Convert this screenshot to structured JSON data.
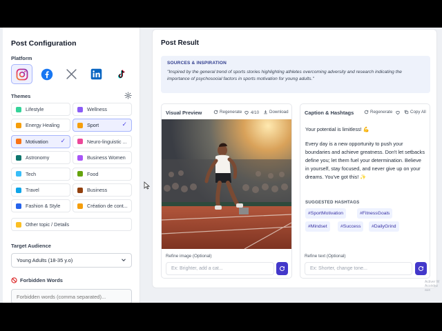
{
  "left_panel": {
    "title": "Post Configuration",
    "platform_label": "Platform",
    "platforms": [
      {
        "name": "Instagram",
        "icon": "instagram-icon",
        "selected": true,
        "color": "#e1306c"
      },
      {
        "name": "Facebook",
        "icon": "facebook-icon",
        "selected": false,
        "color": "#1877f2"
      },
      {
        "name": "X",
        "icon": "x-icon",
        "selected": false,
        "color": "#111111"
      },
      {
        "name": "LinkedIn",
        "icon": "linkedin-icon",
        "selected": false,
        "color": "#0a66c2"
      },
      {
        "name": "TikTok",
        "icon": "tiktok-icon",
        "selected": false,
        "color": "#111111"
      }
    ],
    "themes_label": "Themes",
    "themes": [
      {
        "label": "Lifestyle",
        "icon_color": "#34d399",
        "selected": false
      },
      {
        "label": "Wellness",
        "icon_color": "#8b5cf6",
        "selected": false
      },
      {
        "label": "Energy Healing",
        "icon_color": "#f59e0b",
        "selected": false
      },
      {
        "label": "Sport",
        "icon_color": "#f59e0b",
        "selected": true
      },
      {
        "label": "Motivation",
        "icon_color": "#f97316",
        "selected": true
      },
      {
        "label": "Neuro-linguistic ...",
        "icon_color": "#ec4899",
        "selected": false
      },
      {
        "label": "Astronomy",
        "icon_color": "#0f766e",
        "selected": false
      },
      {
        "label": "Business Women",
        "icon_color": "#a855f7",
        "selected": false
      },
      {
        "label": "Tech",
        "icon_color": "#38bdf8",
        "selected": false
      },
      {
        "label": "Food",
        "icon_color": "#65a30d",
        "selected": false
      },
      {
        "label": "Travel",
        "icon_color": "#0ea5e9",
        "selected": false
      },
      {
        "label": "Business",
        "icon_color": "#92400e",
        "selected": false
      },
      {
        "label": "Fashion & Style",
        "icon_color": "#2563eb",
        "selected": false
      },
      {
        "label": "Création de cont...",
        "icon_color": "#f59e0b",
        "selected": false
      }
    ],
    "other_topic": "Other topic / Details",
    "audience_label": "Target Audience",
    "audience_value": "Young Adults (18-35 y.o)",
    "forbidden_label": "Forbidden Words",
    "forbidden_placeholder": "Forbidden words (comma separated)..."
  },
  "result": {
    "title": "Post Result",
    "sources": {
      "heading": "SOURCES & INSPIRATION",
      "text": "\"Inspired by the general trend of sports stories highlighting athletes overcoming adversity and research indicating the importance of psychosocial factors in sports motivation for young adults.\""
    },
    "visual": {
      "title": "Visual Preview",
      "regenerate": "Regenerate",
      "count": "4/10",
      "download": "Download",
      "refine_label": "Refine image (Optional)",
      "refine_placeholder": "Ex: Brighter, add a cat..."
    },
    "caption": {
      "title": "Caption & Hashtags",
      "regenerate": "Regenerate",
      "copy": "Copy All",
      "paragraphs": [
        "Your potential is limitless! 💪",
        "Every day is a new opportunity to push your boundaries and achieve greatness. Don't let setbacks define you; let them fuel your determination. Believe in yourself, stay focused, and never give up on your dreams. You've got this! ✨"
      ],
      "hashtags_heading": "SUGGESTED HASHTAGS",
      "hashtags": [
        "#SportMotivation",
        "#FitnessGoals",
        "#Mindset",
        "#Success",
        "#DailyGrind"
      ],
      "refine_label": "Refine text (Optional)",
      "refine_placeholder": "Ex: Shorter, change tone..."
    }
  },
  "watermark": [
    "Activer W",
    "Accédez aux"
  ],
  "colors": {
    "accent": "#4338ca",
    "selected_bg": "#eef0ff",
    "selected_border": "#a5b4fc"
  }
}
